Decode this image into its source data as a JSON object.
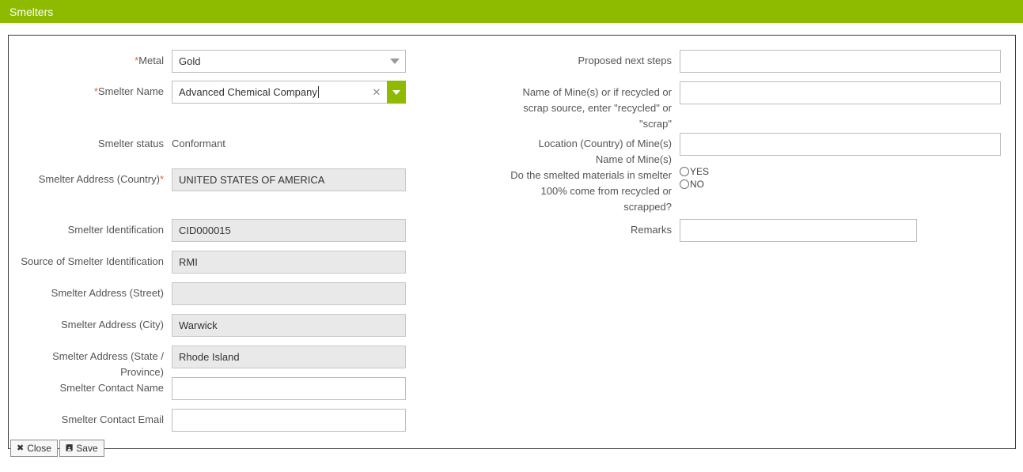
{
  "header": {
    "title": "Smelters"
  },
  "left_column": {
    "metal": {
      "label": "Metal",
      "required": true,
      "required_position": "before",
      "value": "Gold",
      "control": "select",
      "caret_icon": "chevron-down-icon"
    },
    "smelter_name": {
      "label": "Smelter Name",
      "required": true,
      "required_position": "before",
      "value": "Advanced Chemical Company",
      "control": "combobox",
      "focused": true,
      "clear_icon": "close-icon",
      "dropdown_icon": "chevron-down-icon"
    },
    "smelter_status": {
      "label": "Smelter status",
      "required": false,
      "value": "Conformant",
      "control": "static-text"
    },
    "address_country": {
      "label": "Smelter Address (Country)",
      "required": true,
      "required_position": "after",
      "value": "UNITED STATES OF AMERICA",
      "control": "text",
      "disabled": true
    },
    "smelter_identification": {
      "label": "Smelter Identification",
      "required": false,
      "value": "CID000015",
      "control": "text",
      "disabled": true
    },
    "source_of_identification": {
      "label": "Source of Smelter Identification",
      "required": false,
      "value": "RMI",
      "control": "text",
      "disabled": true
    },
    "address_street": {
      "label": "Smelter Address (Street)",
      "required": false,
      "value": "",
      "control": "text",
      "disabled": true
    },
    "address_city": {
      "label": "Smelter Address (City)",
      "required": false,
      "value": "Warwick",
      "control": "text",
      "disabled": true
    },
    "address_state": {
      "label": "Smelter Address (State / Province)",
      "required": false,
      "value": "Rhode Island",
      "control": "text",
      "disabled": true
    },
    "contact_name": {
      "label": "Smelter Contact Name",
      "required": false,
      "value": "",
      "control": "text",
      "disabled": false
    },
    "contact_email": {
      "label": "Smelter Contact Email",
      "required": false,
      "value": "",
      "control": "text",
      "disabled": false
    }
  },
  "right_column": {
    "proposed_next_steps": {
      "label": "Proposed next steps",
      "value": "",
      "control": "text"
    },
    "name_of_mines": {
      "label": "Name of Mine(s) or if recycled or\nscrap source, enter \"recycled\" or\n\"scrap\"",
      "value": "",
      "control": "text"
    },
    "location_of_mines": {
      "label": "Location (Country) of Mine(s)\nName of Mine(s)",
      "value": "",
      "control": "text"
    },
    "recycled_question": {
      "label": "Do the smelted materials in smelter\n100% come from recycled or\nscrapped?",
      "control": "radio-group",
      "selected": "",
      "options": [
        {
          "label": "YES",
          "value": "YES",
          "checked": false
        },
        {
          "label": "NO",
          "value": "NO",
          "checked": false
        }
      ]
    },
    "remarks": {
      "label": "Remarks",
      "value": "",
      "control": "text"
    }
  },
  "footer": {
    "close_button": {
      "label": "Close",
      "icon": "close-icon",
      "glyph": "✖"
    },
    "save_button": {
      "label": "Save",
      "icon": "save-floppy-icon",
      "glyph": "ὋE"
    }
  },
  "colors": {
    "brand_green": "#8EBB00",
    "required_red": "#e8603c",
    "disabled_field_bg": "#e9e9e9",
    "panel_border": "#3a3a3a"
  }
}
